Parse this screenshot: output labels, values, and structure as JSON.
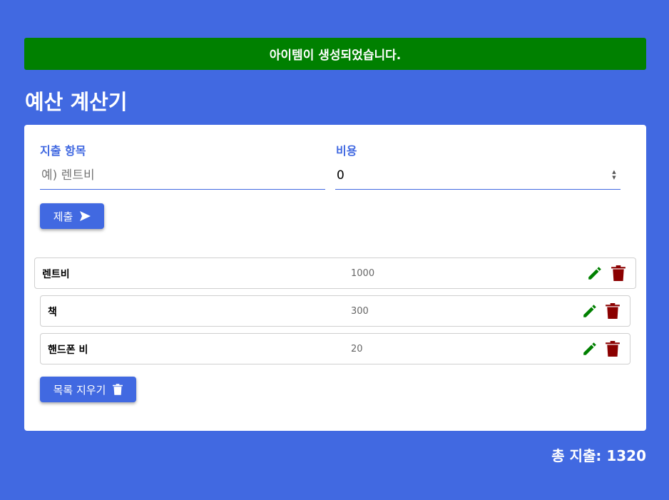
{
  "alert": {
    "text": "아이템이 생성되었습니다.",
    "color": "#008000"
  },
  "title": "예산 계산기",
  "form": {
    "expense_label": "지출 항목",
    "expense_placeholder": "예) 렌트비",
    "cost_label": "비용",
    "cost_value": "0",
    "submit_label": "제출"
  },
  "items": [
    {
      "name": "렌트비",
      "cost": "1000"
    },
    {
      "name": "책",
      "cost": "300"
    },
    {
      "name": "핸드폰 비",
      "cost": "20"
    }
  ],
  "clear_label": "목록 지우기",
  "total": {
    "text": "총 지출: 1320"
  },
  "colors": {
    "accent": "#4169e1",
    "edit": "#008000",
    "delete": "#8b0000"
  },
  "icons": {
    "submit": "send-icon",
    "edit": "pencil-icon",
    "delete": "trash-icon"
  }
}
